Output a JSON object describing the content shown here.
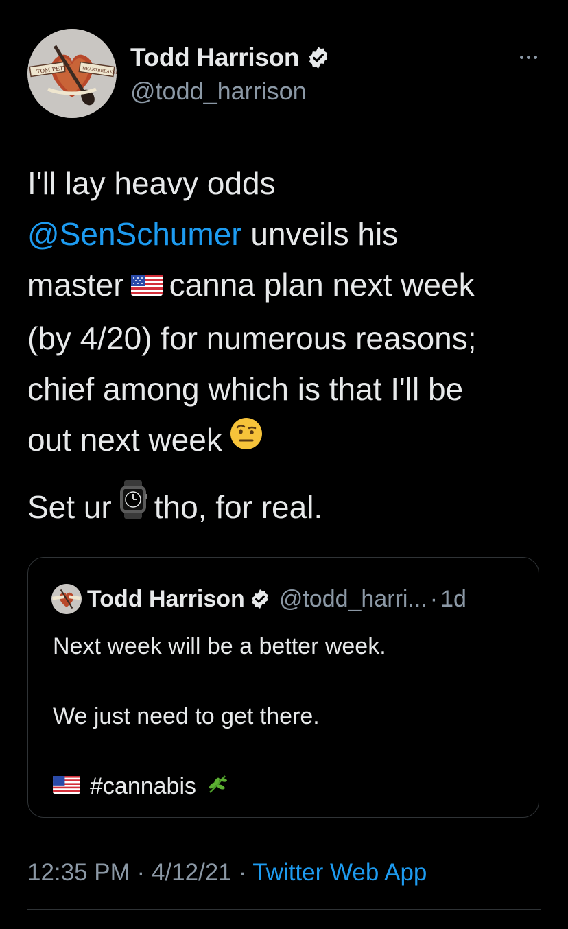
{
  "tweet": {
    "author": {
      "name": "Todd Harrison",
      "handle": "@todd_harrison",
      "verified": true
    },
    "text_parts": {
      "line1": "I'll lay heavy odds",
      "mention": "@SenSchumer",
      "after_mention": " unveils his",
      "before_flag": "master",
      "after_flag": "canna plan next week",
      "line4": "(by 4/20) for numerous reasons;",
      "line5": "chief among which is that I'll be",
      "line6": "out next week",
      "para2_before": "Set ur",
      "para2_after": "tho, for real."
    },
    "emojis": {
      "flag": "us-flag-emoji",
      "raised_eyebrow": "face-with-raised-eyebrow-emoji",
      "watch": "watch-emoji"
    },
    "timestamp": "12:35 PM",
    "date": "4/12/21",
    "separator": "·",
    "source": "Twitter Web App"
  },
  "quoted_tweet": {
    "author": {
      "name": "Todd Harrison",
      "handle": "@todd_harri...",
      "verified": true
    },
    "separator": "·",
    "age": "1d",
    "line1": "Next week will be a better week.",
    "line2": "We just need to get there.",
    "hashtag": "#cannabis",
    "hashtag_emoji": "herb-emoji"
  },
  "colors": {
    "background": "#000000",
    "text": "#e7e9ea",
    "secondary": "#8b98a5",
    "link": "#1d9bf0",
    "border": "#2f3336"
  }
}
